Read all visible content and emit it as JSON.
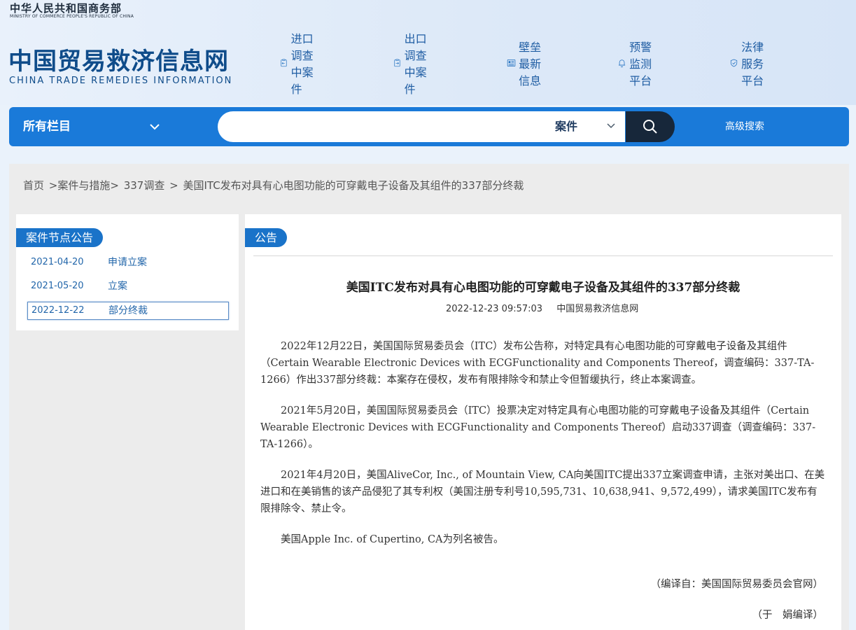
{
  "header": {
    "ministry_cn": "中华人民共和国商务部",
    "ministry_en": "MINISTRY OF COMMERCE PEOPLE'S REPUBLIC OF CHINA",
    "brand_cn": "中国贸易救济信息网",
    "brand_en": "CHINA TRADE REMEDIES INFORMATION",
    "nav": [
      {
        "label": "进口调查中案件",
        "icon": "import-clipboard-icon"
      },
      {
        "label": "出口调查中案件",
        "icon": "export-clipboard-icon"
      },
      {
        "label": "壁垒最新信息",
        "icon": "news-panel-icon"
      },
      {
        "label": "预警监测平台",
        "icon": "bell-icon"
      },
      {
        "label": "法律服务平台",
        "icon": "shield-check-icon"
      }
    ]
  },
  "search": {
    "all_columns": "所有栏目",
    "placeholder": "",
    "category": "案件",
    "advanced": "高级搜索"
  },
  "breadcrumb": [
    "首页",
    ">案件与措施>",
    "337调查",
    ">",
    "美国ITC发布对具有心电图功能的可穿戴电子设备及其组件的337部分终裁"
  ],
  "sidebar": {
    "title": "案件节点公告",
    "items": [
      {
        "date": "2021-04-20",
        "label": "申请立案"
      },
      {
        "date": "2021-05-20",
        "label": "立案"
      },
      {
        "date": "2022-12-22",
        "label": "部分终裁"
      }
    ]
  },
  "article": {
    "section": "公告",
    "title": "美国ITC发布对具有心电图功能的可穿戴电子设备及其组件的337部分终裁",
    "datetime": "2022-12-23 09:57:03",
    "source": "中国贸易救济信息网",
    "paragraphs": [
      "2022年12月22日，美国国际贸易委员会（ITC）发布公告称，对特定具有心电图功能的可穿戴电子设备及其组件（Certain Wearable Electronic Devices with ECGFunctionality and Components Thereof，调查编码：337-TA-1266）作出337部分终裁：本案存在侵权，发布有限排除令和禁止令但暂缓执行，终止本案调查。",
      "2021年5月20日，美国国际贸易委员会（ITC）投票决定对特定具有心电图功能的可穿戴电子设备及其组件（Certain Wearable Electronic Devices with ECGFunctionality and Components Thereof）启动337调查（调查编码：337-TA-1266）。",
      "2021年4月20日，美国AliveCor, Inc., of Mountain View, CA向美国ITC提出337立案调查申请，主张对美出口、在美进口和在美销售的该产品侵犯了其专利权（美国注册专利号10,595,731、10,638,941、9,572,499），请求美国ITC发布有限排除令、禁止令。",
      "美国Apple Inc. of Cupertino, CA为列名被告。"
    ],
    "translated_from": "（编译自：美国国际贸易委员会官网）",
    "translator": "（于　娟编译）"
  },
  "colors": {
    "accent": "#1a7ad9",
    "dark_button": "#17273a",
    "brand": "#0f4c8a",
    "link": "#2266aa"
  }
}
